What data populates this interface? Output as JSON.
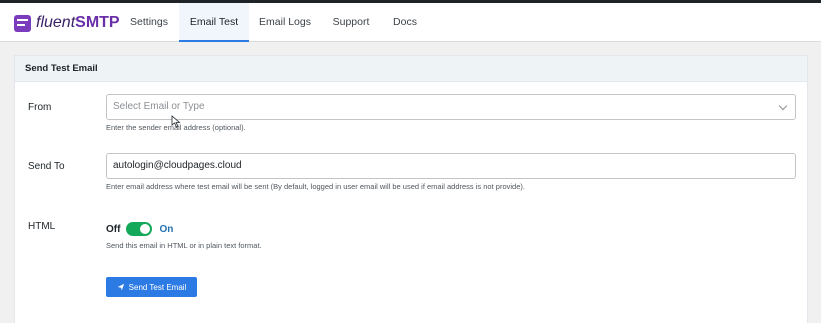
{
  "brand": {
    "prefix": "fluent",
    "strong": "SMTP",
    "color": "#6a2fa8"
  },
  "tabs": [
    {
      "label": "Settings",
      "active": false
    },
    {
      "label": "Email Test",
      "active": true
    },
    {
      "label": "Email Logs",
      "active": false
    },
    {
      "label": "Support",
      "active": false
    },
    {
      "label": "Docs",
      "active": false
    }
  ],
  "panel": {
    "title": "Send Test Email",
    "from": {
      "label": "From",
      "placeholder": "Select Email or Type",
      "value": "",
      "help": "Enter the sender email address (optional)."
    },
    "send_to": {
      "label": "Send To",
      "value": "autologin@cloudpages.cloud",
      "help": "Enter email address where test email will be sent (By default, logged in user email will be used if email address is not provide)."
    },
    "html": {
      "label": "HTML",
      "off_label": "Off",
      "on_label": "On",
      "enabled": true,
      "help": "Send this email in HTML or in plain text format."
    },
    "submit_label": "Send Test Email"
  },
  "colors": {
    "accent": "#2c7be5",
    "toggle_on": "#13a85a",
    "brand": "#7b3bbd"
  },
  "icons": [
    "brand-logo-icon",
    "chevron-down-icon",
    "paper-plane-icon",
    "mouse-cursor-icon"
  ]
}
